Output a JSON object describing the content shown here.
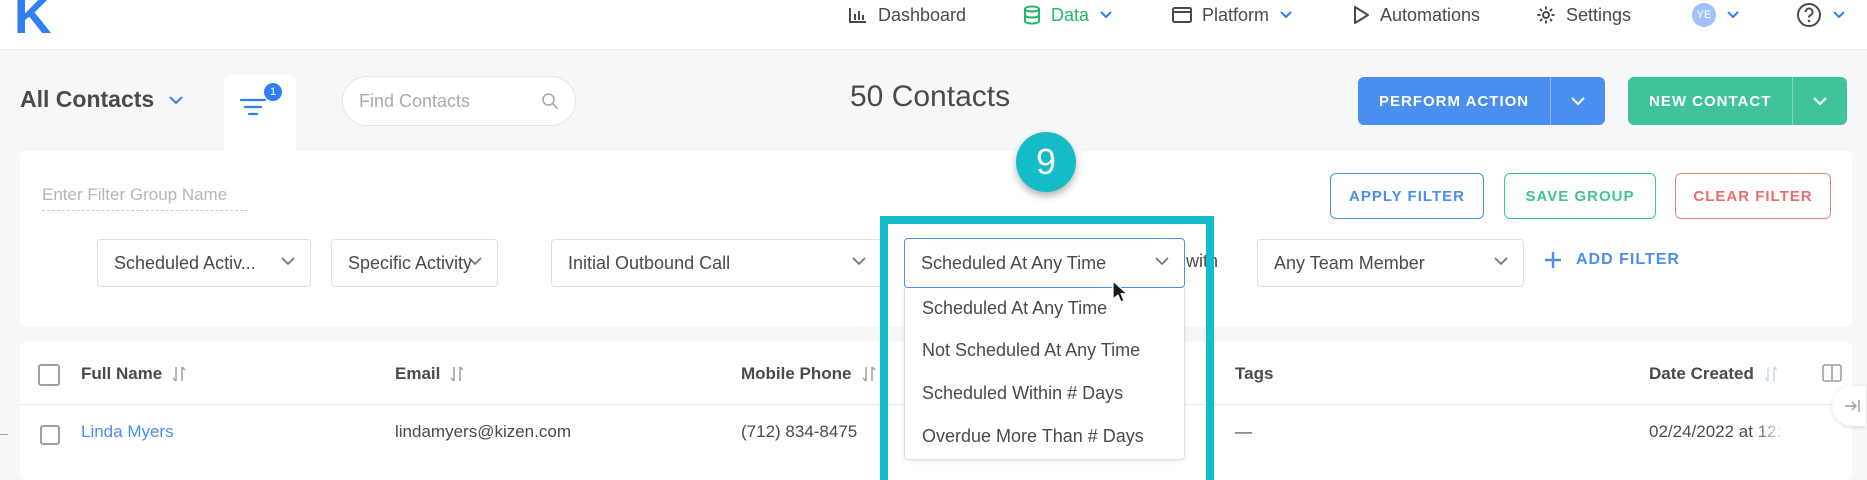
{
  "brand": {
    "logo": "K"
  },
  "nav": {
    "items": [
      {
        "label": "Dashboard",
        "icon": "bar-chart-icon"
      },
      {
        "label": "Data",
        "icon": "database-icon",
        "active": true
      },
      {
        "label": "Platform",
        "icon": "browser-window-icon"
      },
      {
        "label": "Automations",
        "icon": "play-icon"
      },
      {
        "label": "Settings",
        "icon": "gear-icon"
      }
    ],
    "avatar_initials": "YE",
    "help_icon": "help-circle-icon"
  },
  "header": {
    "view_title": "All Contacts",
    "filter_badge_count": "1",
    "search_placeholder": "Find Contacts",
    "count_title": "50 Contacts",
    "perform_action_label": "PERFORM ACTION",
    "new_contact_label": "NEW CONTACT"
  },
  "filter_panel": {
    "group_name_placeholder": "Enter Filter Group Name",
    "apply_label": "APPLY FILTER",
    "save_label": "SAVE GROUP",
    "clear_label": "CLEAR FILTER",
    "selects": {
      "field": "Scheduled Activ...",
      "activity_type": "Specific Activity",
      "activity": "Initial Outbound Call",
      "schedule": "Scheduled At Any Time",
      "with_text": "with",
      "member": "Any Team Member"
    },
    "add_filter_label": "ADD FILTER"
  },
  "schedule_dropdown": {
    "options": [
      "Scheduled At Any Time",
      "Not Scheduled At Any Time",
      "Scheduled Within # Days",
      "Overdue More Than # Days"
    ]
  },
  "step_badge": "9",
  "table": {
    "columns": [
      "Full Name",
      "Email",
      "Mobile Phone",
      "Tags",
      "Date Created"
    ],
    "rows": [
      {
        "name": "Linda Myers",
        "email": "lindamyers@kizen.com",
        "phone": "(712) 834-8475",
        "tags": "—",
        "date": "02/24/2022 at 12:"
      }
    ]
  },
  "colors": {
    "accent_blue": "#4a8ef0",
    "accent_green": "#3ec39b",
    "danger_red": "#ec6b6b",
    "highlight_teal": "#14bcc7"
  }
}
